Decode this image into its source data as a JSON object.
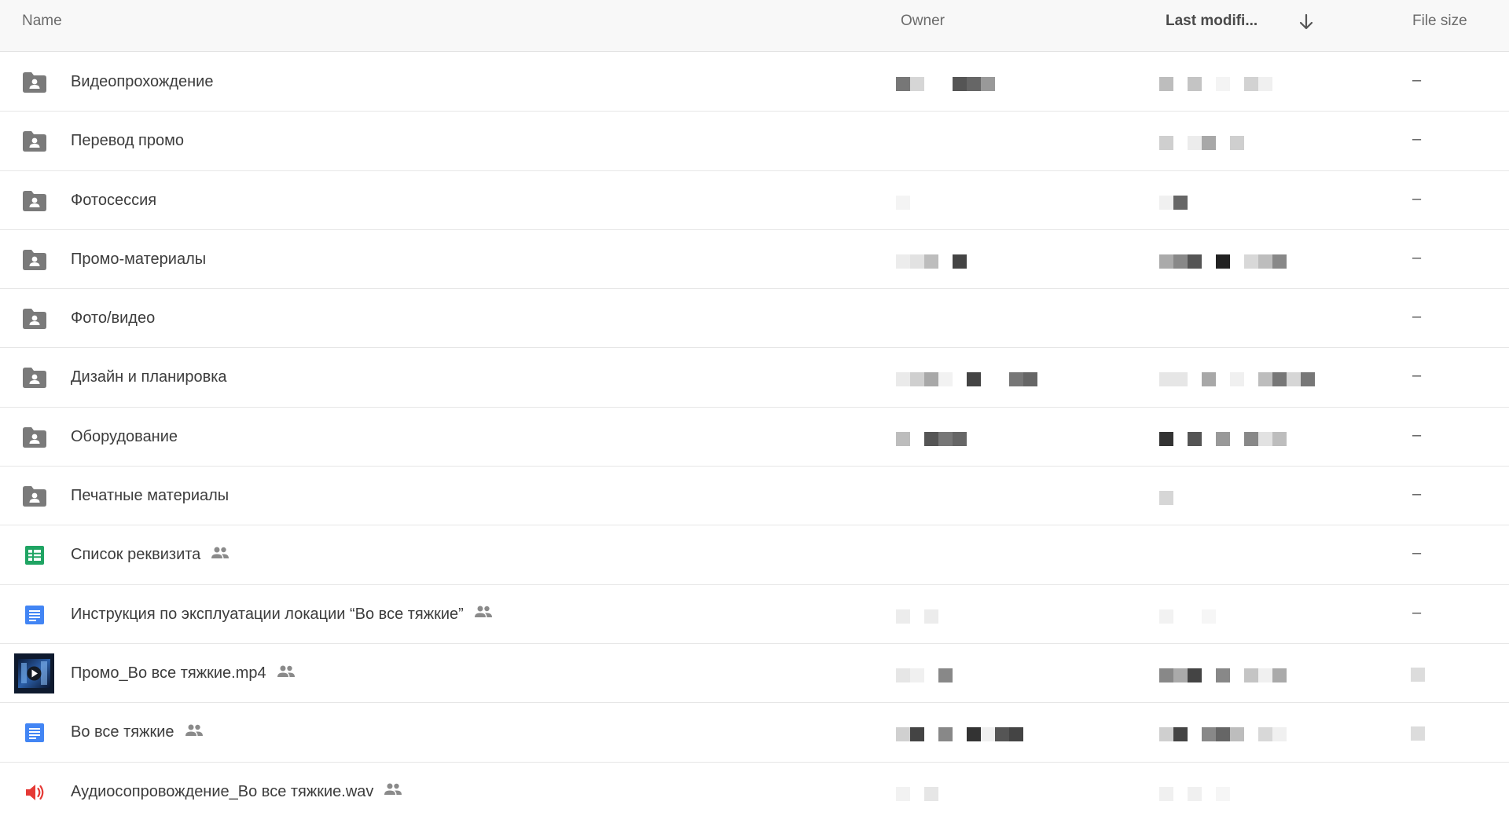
{
  "header": {
    "name": "Name",
    "owner": "Owner",
    "modified": "Last modifi...",
    "size": "File size"
  },
  "rows": [
    {
      "name": "Видеопрохождение",
      "icon": "shared-folder-icon",
      "shared": false,
      "size": "–"
    },
    {
      "name": "Перевод промо",
      "icon": "shared-folder-icon",
      "shared": false,
      "size": "–"
    },
    {
      "name": "Фотосессия",
      "icon": "shared-folder-icon",
      "shared": false,
      "size": "–"
    },
    {
      "name": "Промо-материалы",
      "icon": "shared-folder-icon",
      "shared": false,
      "size": "–"
    },
    {
      "name": "Фото/видео",
      "icon": "shared-folder-icon",
      "shared": false,
      "size": "–"
    },
    {
      "name": "Дизайн и планировка",
      "icon": "shared-folder-icon",
      "shared": false,
      "size": "–"
    },
    {
      "name": "Оборудование",
      "icon": "shared-folder-icon",
      "shared": false,
      "size": "–"
    },
    {
      "name": "Печатные материалы",
      "icon": "shared-folder-icon",
      "shared": false,
      "size": "–"
    },
    {
      "name": "Список реквизита",
      "icon": "google-sheets-icon",
      "shared": true,
      "size": "–"
    },
    {
      "name": "Инструкция по эксплуатации локации “Во все тяжкие”",
      "icon": "google-docs-icon",
      "shared": true,
      "size": "–"
    },
    {
      "name": "Промо_Во все тяжкие.mp4",
      "icon": "video-thumbnail-icon",
      "shared": true,
      "size": ""
    },
    {
      "name": "Во все тяжкие",
      "icon": "google-docs-icon",
      "shared": true,
      "size": ""
    },
    {
      "name": "Аудиосопровождение_Во все тяжкие.wav",
      "icon": "audio-file-icon",
      "shared": true,
      "size": ""
    }
  ],
  "colors": {
    "folder": "#7a7a7a",
    "sheets": "#1fa463",
    "docs": "#4285f4",
    "audio": "#e53935",
    "header_bg": "#f8f8f8"
  }
}
